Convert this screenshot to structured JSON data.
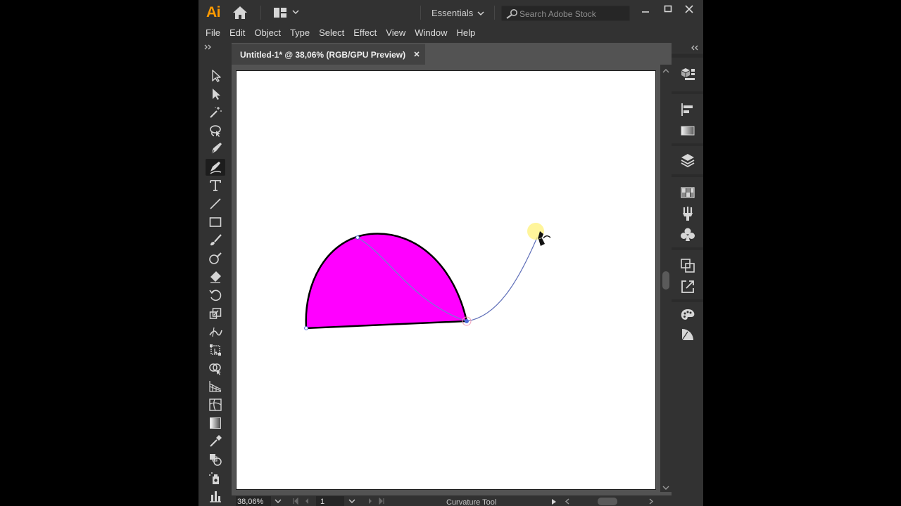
{
  "app": {
    "logo": "Ai",
    "workspace": "Essentials",
    "stock_search_placeholder": "Search Adobe Stock"
  },
  "menu": [
    "File",
    "Edit",
    "Object",
    "Type",
    "Select",
    "Effect",
    "View",
    "Window",
    "Help"
  ],
  "document": {
    "tab_title": "Untitled-1* @ 38,06% (RGB/GPU Preview)",
    "fill_color": "#ff00ff",
    "stroke_color": "#000000"
  },
  "status": {
    "zoom": "38,06%",
    "artboard_number": "1",
    "current_tool": "Curvature Tool"
  },
  "tools": [
    "selection-tool",
    "direct-selection-tool",
    "magic-wand-tool",
    "lasso-tool",
    "pen-tool",
    "curvature-tool",
    "type-tool",
    "line-segment-tool",
    "rectangle-tool",
    "paintbrush-tool",
    "shaper-tool",
    "eraser-tool",
    "rotate-tool",
    "scale-tool",
    "width-tool",
    "free-transform-tool",
    "shape-builder-tool",
    "perspective-grid-tool",
    "mesh-tool",
    "gradient-tool",
    "eyedropper-tool",
    "blend-tool",
    "symbol-sprayer-tool",
    "column-graph-tool"
  ],
  "active_tool": "curvature-tool",
  "panels": [
    "libraries-panel",
    "align-panel",
    "gradient-panel",
    "layers-panel",
    "swatches-panel",
    "brushes-panel",
    "symbols-panel",
    "pathfinder-panel",
    "export-panel",
    "color-panel",
    "color-guide-panel"
  ],
  "colors": {
    "chrome": "#323232",
    "canvas": "#535353",
    "accent": "#ff9a00"
  }
}
